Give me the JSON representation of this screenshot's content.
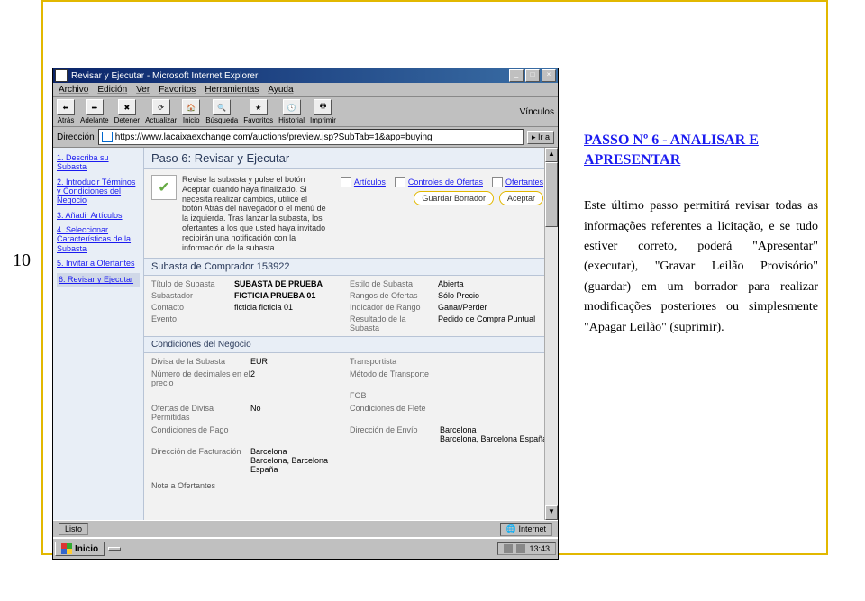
{
  "page_number": "10",
  "heading": "PASSO Nº 6 - ANALISAR E APRESENTAR",
  "body": "Este último passo permitirá revisar todas as informações referentes a licitação, e se tudo estiver correto, poderá \"Apresentar\" (executar), \"Gravar Leilão Provisório\" (guardar) em um borrador para realizar modificações posteriores ou simplesmente \"Apagar Leilão\" (suprimir).",
  "browser": {
    "title": "Revisar y Ejecutar - Microsoft Internet Explorer",
    "menu": [
      "Archivo",
      "Edición",
      "Ver",
      "Favoritos",
      "Herramientas",
      "Ayuda"
    ],
    "toolbar": [
      "Atrás",
      "Adelante",
      "Detener",
      "Actualizar",
      "Inicio",
      "Búsqueda",
      "Favoritos",
      "Historial",
      "Imprimir"
    ],
    "links_label": "Vínculos",
    "addr_label": "Dirección",
    "url": "https://www.lacaixaexchange.com/auctions/preview.jsp?SubTab=1&app=buying",
    "go": "Ir a",
    "status": "Listo",
    "status_right": "Internet"
  },
  "nav": {
    "items": [
      "1. Describa su Subasta",
      "2. Introducir Términos y Condiciones del Negocio",
      "3. Añadir Artículos",
      "4. Seleccionar Características de la Subasta",
      "5. Invitar a Ofertantes",
      "6. Revisar y Ejecutar"
    ]
  },
  "step": {
    "title": "Paso 6: Revisar y Ejecutar",
    "intro": "Revise la subasta y pulse el botón Aceptar cuando haya finalizado. Si necesita realizar cambios, utilice el botón Atrás del navegador o el menú de la izquierda. Tras lanzar la subasta, los ofertantes a los que usted haya invitado recibirán una notificación con la información de la subasta.",
    "tabs": [
      "Artículos",
      "Controles de Ofertas",
      "Ofertantes"
    ],
    "btn_guardar": "Guardar Borrador",
    "btn_aceptar": "Aceptar"
  },
  "subasta": {
    "header": "Subasta de Comprador 153922",
    "rows": {
      "titulo_lbl": "Título de Subasta",
      "titulo_val": "SUBASTA DE PRUEBA",
      "estilo_lbl": "Estilo de Subasta",
      "estilo_val": "Abierta",
      "subastador_lbl": "Subastador",
      "subastador_val": "FICTICIA PRUEBA 01",
      "rangos_lbl": "Rangos de Ofertas",
      "rangos_val": "Sólo Precio",
      "contacto_lbl": "Contacto",
      "contacto_val": "ficticia ficticia 01",
      "indicador_lbl": "Indicador de Rango",
      "indicador_val": "Ganar/Perder",
      "evento_lbl": "Evento",
      "evento_val": "",
      "resultado_lbl": "Resultado de la Subasta",
      "resultado_val": "Pedido de Compra Puntual"
    }
  },
  "cond": {
    "title": "Condiciones del Negocio",
    "divisa_lbl": "Divisa de la Subasta",
    "divisa_val": "EUR",
    "transportista_lbl": "Transportista",
    "dec_lbl": "Número de decimales en el precio",
    "dec_val": "2",
    "metodo_lbl": "Método de Transporte",
    "fob_lbl": "FOB",
    "ofertas_div_lbl": "Ofertas de Divisa Permitidas",
    "ofertas_div_val": "No",
    "cond_flete_lbl": "Condiciones de Flete",
    "cond_pago_lbl": "Condiciones de Pago",
    "dir_envio_lbl": "Dirección de Envío",
    "dir_envio_val1": "Barcelona",
    "dir_envio_val2": "Barcelona, Barcelona España",
    "dir_fact_lbl": "Dirección de Facturación",
    "dir_fact_val1": "Barcelona",
    "dir_fact_val2": "Barcelona, Barcelona España",
    "nota_lbl": "Nota a Ofertantes"
  },
  "taskbar": {
    "start": "Inicio",
    "clock": "13:43"
  }
}
